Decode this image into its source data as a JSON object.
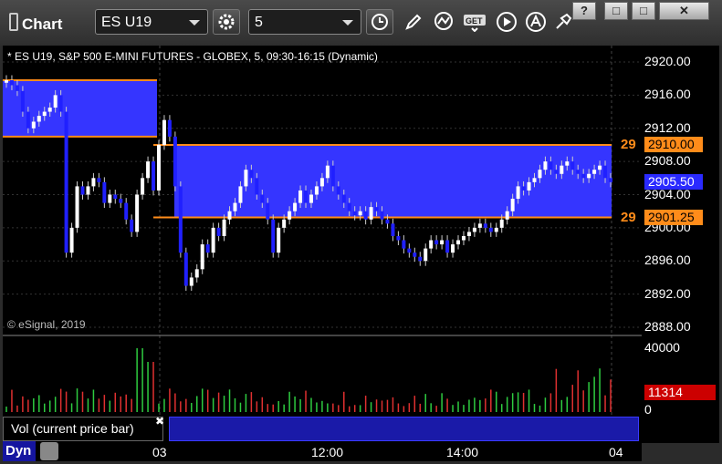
{
  "toolbar": {
    "app_title": "Chart",
    "symbol": "ES U19",
    "interval": "5",
    "window_buttons": [
      "?",
      "□",
      "□",
      "✕"
    ]
  },
  "chart": {
    "header": "* ES U19, S&P 500 E-MINI FUTURES - GLOBEX, 5, 09:30-16:15 (Dynamic)",
    "copyright": "© eSignal, 2019",
    "price_ticks": [
      "2920.00",
      "2916.00",
      "2912.00",
      "2908.00",
      "2904.00",
      "2900.00",
      "2896.00",
      "2892.00",
      "2888.00"
    ],
    "price_tick_values": [
      2920,
      2916,
      2912,
      2908,
      2904,
      2900,
      2896,
      2892,
      2888
    ],
    "markers": {
      "upper_label": "29",
      "upper_value": "2910.00",
      "current_value": "2905.50",
      "lower_label": "29",
      "lower_value": "2901.25"
    },
    "zones": [
      {
        "from_price": 2911.0,
        "to_price": 2917.8
      },
      {
        "from_price": 2901.25,
        "to_price": 2910.0
      }
    ],
    "colors": {
      "zone": "#3535ff",
      "level_line": "#ff8c1a",
      "up": "#ffffff",
      "down": "#2020ff",
      "vol_up": "#2ecc40",
      "vol_down": "#e03030"
    },
    "time_ticks": [
      "03",
      "12:00",
      "14:00",
      "04"
    ],
    "volume": {
      "ticks": [
        "40000",
        "0"
      ],
      "current": "11314",
      "label": "Vol (current price bar)"
    },
    "dyn_label": "Dyn"
  },
  "chart_data": {
    "type": "candlestick",
    "title": "ES U19, S&P 500 E-MINI FUTURES - GLOBEX, 5, 09:30-16:15 (Dynamic)",
    "ylim": [
      2888,
      2921
    ],
    "x": [
      "d1-01",
      "d1-02",
      "d1-03",
      "d1-04",
      "d1-05",
      "d1-06",
      "d1-07",
      "d1-08",
      "d1-09",
      "d1-10",
      "d1-11",
      "d1-12",
      "d1-13",
      "d1-14",
      "d1-15",
      "d1-16",
      "d1-17",
      "d1-18",
      "d1-19",
      "d1-20",
      "d1-21",
      "d1-22",
      "d1-23",
      "d1-24",
      "d2-01",
      "d2-02",
      "d2-03",
      "d2-04",
      "d2-05",
      "d2-06",
      "d2-07",
      "d2-08",
      "d2-09",
      "d2-10",
      "d2-11",
      "d2-12",
      "d2-13",
      "d2-14",
      "d2-15",
      "d2-16",
      "d2-17",
      "d2-18",
      "d2-19",
      "d2-20",
      "d2-21",
      "d2-22",
      "d2-23",
      "d2-24",
      "d2-25",
      "d2-26",
      "d2-27",
      "d2-28",
      "d2-29",
      "d2-30",
      "d2-31",
      "d2-32",
      "d2-33",
      "d2-34",
      "d2-35",
      "d2-36",
      "d2-37",
      "d2-38",
      "d2-39",
      "d2-40",
      "d2-41",
      "d2-42",
      "d2-43",
      "d2-44",
      "d2-45",
      "d2-46",
      "d2-47",
      "d2-48",
      "d2-49",
      "d2-50",
      "d2-51",
      "d2-52",
      "d2-53",
      "d2-54",
      "d2-55",
      "d2-56",
      "d2-57",
      "d2-58",
      "d2-59",
      "d2-60",
      "d2-61",
      "d2-62",
      "d2-63",
      "d2-64",
      "d2-65",
      "d2-66",
      "d2-67",
      "d2-68",
      "d2-69",
      "d2-70",
      "d2-71",
      "d2-72",
      "d2-73",
      "d2-74",
      "d2-75",
      "d2-76",
      "d2-77",
      "d2-78",
      "d2-79",
      "d2-80",
      "d2-81",
      "d2-82",
      "d2-83",
      "d2-84",
      "d2-85",
      "d2-86",
      "d2-87",
      "d2-88",
      "d2-89",
      "d2-90",
      "d2-91",
      "d2-92"
    ],
    "open": [
      2917.5,
      2917.8,
      2917.2,
      2916.5,
      2914.0,
      2912.0,
      2912.8,
      2913.5,
      2914.0,
      2914.5,
      2916.0,
      2914.0,
      2897.0,
      2900.0,
      2905.0,
      2904.0,
      2905.0,
      2906.0,
      2905.5,
      2903.0,
      2904.0,
      2903.5,
      2903.0,
      2901.0,
      2899.5,
      2904.0,
      2906.0,
      2908.0,
      2904.5,
      2910.0,
      2913.0,
      2911.0,
      2905.0,
      2897.0,
      2893.0,
      2894.0,
      2895.0,
      2898.0,
      2897.0,
      2900.0,
      2899.0,
      2901.0,
      2902.0,
      2903.0,
      2905.0,
      2907.0,
      2906.0,
      2904.0,
      2903.0,
      2901.0,
      2897.0,
      2900.0,
      2901.0,
      2902.0,
      2903.0,
      2904.5,
      2903.0,
      2904.0,
      2905.0,
      2906.0,
      2907.5,
      2905.0,
      2904.0,
      2903.0,
      2902.0,
      2901.5,
      2902.0,
      2901.0,
      2902.5,
      2902.0,
      2901.0,
      2900.5,
      2899.0,
      2898.5,
      2897.5,
      2897.0,
      2896.5,
      2896.0,
      2897.5,
      2898.5,
      2898.0,
      2898.5,
      2897.0,
      2898.0,
      2898.5,
      2899.0,
      2899.5,
      2900.0,
      2900.5,
      2900.0,
      2899.5,
      2900.0,
      2901.0,
      2902.0,
      2903.5,
      2905.0,
      2904.5,
      2905.5,
      2906.0,
      2907.0,
      2908.0,
      2907.0,
      2906.5,
      2907.5,
      2908.0,
      2907.0,
      2906.5,
      2906.0,
      2906.5,
      2907.0,
      2907.5,
      2906.0
    ],
    "close": [
      2917.8,
      2917.2,
      2916.5,
      2914.0,
      2912.0,
      2912.8,
      2913.5,
      2914.0,
      2914.5,
      2916.0,
      2914.0,
      2897.0,
      2900.0,
      2905.0,
      2904.0,
      2905.0,
      2906.0,
      2905.5,
      2903.0,
      2904.0,
      2903.5,
      2903.0,
      2901.0,
      2899.5,
      2904.0,
      2906.0,
      2908.0,
      2904.5,
      2910.0,
      2913.0,
      2911.0,
      2905.0,
      2897.0,
      2893.0,
      2894.0,
      2895.0,
      2898.0,
      2897.0,
      2900.0,
      2899.0,
      2901.0,
      2902.0,
      2903.0,
      2905.0,
      2907.0,
      2906.0,
      2904.0,
      2903.0,
      2901.0,
      2897.0,
      2900.0,
      2901.0,
      2902.0,
      2903.0,
      2904.5,
      2903.0,
      2904.0,
      2905.0,
      2906.0,
      2907.5,
      2905.0,
      2904.0,
      2903.0,
      2902.0,
      2901.5,
      2902.0,
      2901.0,
      2902.5,
      2902.0,
      2901.0,
      2900.5,
      2899.0,
      2898.5,
      2897.5,
      2897.0,
      2896.5,
      2896.0,
      2897.5,
      2898.5,
      2898.0,
      2898.5,
      2897.0,
      2898.0,
      2898.5,
      2899.0,
      2899.5,
      2900.0,
      2900.5,
      2900.0,
      2899.5,
      2900.0,
      2901.0,
      2902.0,
      2903.5,
      2905.0,
      2904.5,
      2905.5,
      2906.0,
      2907.0,
      2908.0,
      2907.0,
      2906.5,
      2907.5,
      2908.0,
      2907.0,
      2906.5,
      2906.0,
      2906.5,
      2907.0,
      2907.5,
      2906.0,
      2905.5
    ],
    "volume_ylim": [
      0,
      40000
    ],
    "current_volume": 11314
  }
}
